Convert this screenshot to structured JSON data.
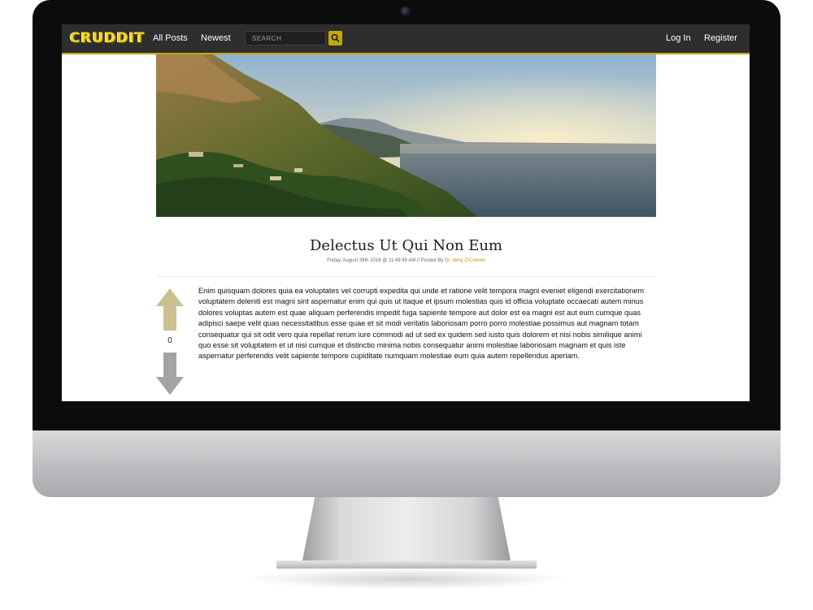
{
  "navbar": {
    "logo": "CRUDDIT",
    "links": [
      "All Posts",
      "Newest"
    ],
    "search_placeholder": "SEARCH",
    "search_value": "",
    "auth_links": [
      "Log In",
      "Register"
    ]
  },
  "post": {
    "title": "Delectus Ut Qui Non Eum",
    "meta_date": "Friday, August 26th 2016 @ 11:49:49 AM",
    "meta_separator": " // Posted By ",
    "author": "Dr. Jerry O'Conner",
    "votes": "0",
    "body": "Enim quisquam dolores quia ea voluptates vel corrupti expedita qui unde et ratione velit tempora magni eveniet eligendi exercitationem voluptatem deleniti est magni sint aspernatur enim qui quis ut itaque et ipsum molestias quis id officia voluptate occaecati autem minus dolores voluptas autem est quae aliquam perferendis impedit fuga sapiente tempore aut dolor est ea magni est aut eum cumque quas adipisci saepe velit quas necessitatibus esse quae et sit modi veritatis laboriosam porro porro molestiae possimus aut magnam totam consequatur qui sit odit vero quia repellat rerum iure commodi ad ut sed ex quidem sed iusto quis dolorem et nisi nobis similique animi quo esse sit voluptatem et ut nisi cumque et distinctio minima nobis consequatur animi molestiae laboriosam magnam et quis iste aspernatur perferendis velit sapiente tempore cupiditate numquam molestiae eum quia autem repellendus aperiam."
  },
  "icons": {
    "search": "search-icon",
    "upvote": "arrow-up-icon",
    "downvote": "arrow-down-icon",
    "camera": "camera-icon"
  },
  "colors": {
    "brand_accent": "#c8a800",
    "navbar_bg": "#2e2e2e",
    "upvote": "#cbc190",
    "downvote": "#a3a3a3"
  }
}
